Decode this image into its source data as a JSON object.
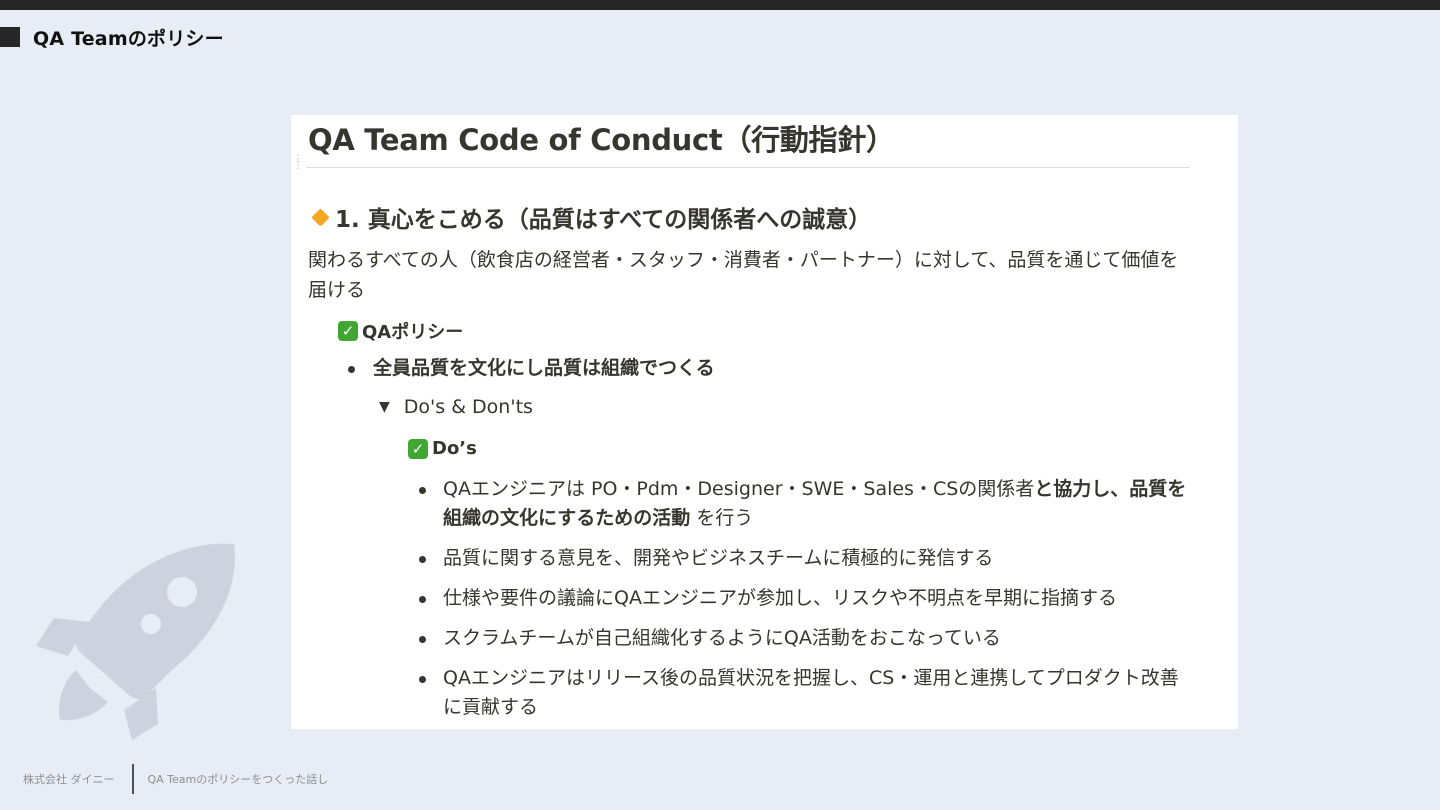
{
  "slide": {
    "title": "QA Teamのポリシー"
  },
  "footer": {
    "company": "株式会社 ダイニー",
    "talk_title": "QA Teamのポリシーをつくった話し"
  },
  "document": {
    "title": "QA Team Code of Conduct（行動指針）",
    "section_heading": "1. 真心をこめる（品質はすべての関係者への誠意）",
    "section_description": "関わるすべての人（飲食店の経営者・スタッフ・消費者・パートナー）に対して、品質を通じて価値を届ける",
    "policy_label": "QAポリシー",
    "policy_item": "全員品質を文化にし品質は組織でつくる",
    "toggle_label": "Do's & Don'ts",
    "dos_label": "Do’s",
    "dos_items": [
      {
        "text_a": "QAエンジニアは PO・Pdm・Designer・SWE・Sales・CSの関係者",
        "text_b": "と協力し、品質を組織の文化にするための活動",
        "text_c": " を行う"
      },
      {
        "text": "品質に関する意見を、開発やビジネスチームに積極的に発信する"
      },
      {
        "text": "仕様や要件の議論にQAエンジニアが参加し、リスクや不明点を早期に指摘する"
      },
      {
        "text": "スクラムチームが自己組織化するようにQA活動をおこなっている"
      },
      {
        "text": "QAエンジニアはリリース後の品質状況を把握し、CS・運用と連携してプロダクト改善に貢献する"
      }
    ]
  },
  "icons": {
    "header_marker": "square-marker-icon",
    "section_marker": "orange-diamond-icon",
    "check": "check-mark-icon",
    "toggle": "toggle-triangle-icon",
    "decoration": "rocket-icon",
    "drag": "drag-handle-icon"
  },
  "colors": {
    "background": "#e8ecf5",
    "top_bar": "#262626",
    "diamond": "#f5a623",
    "check_green": "#40a832",
    "rocket": "#cdd3de"
  }
}
